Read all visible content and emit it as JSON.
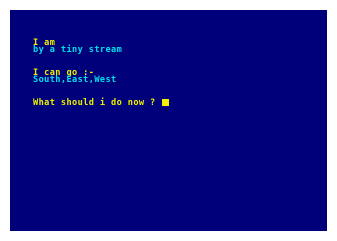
{
  "location": {
    "heading": "I am",
    "description": "by a tiny stream"
  },
  "exits": {
    "heading": "I can go :-",
    "directions": "South,East,West"
  },
  "prompt": {
    "text": "What should i do now ? "
  },
  "colors": {
    "screen_background": "#00007a",
    "border": "#ffffff",
    "heading_text": "#f0f000",
    "info_text": "#00e0e8",
    "cursor": "#f0f000"
  }
}
